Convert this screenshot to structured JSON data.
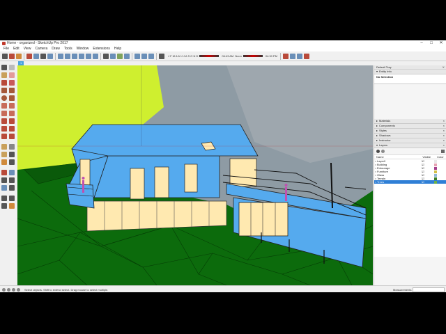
{
  "window": {
    "title": "Home - organized - SketchUp Pro 2017",
    "controls": [
      "–",
      "□",
      "✕"
    ]
  },
  "menus": [
    "File",
    "Edit",
    "View",
    "Camera",
    "Draw",
    "Tools",
    "Window",
    "Extensions",
    "Help"
  ],
  "shadow_settings": {
    "months": "J F M A M J J A S O N D",
    "time_start": "06:43 AM",
    "noon": "Noon",
    "time_end": "04:30 PM"
  },
  "scene_tab": "1",
  "tray": {
    "title": "Default Tray",
    "entity_info": {
      "label": "Entity Info",
      "value": "No Selection"
    },
    "panels": [
      {
        "label": "Materials"
      },
      {
        "label": "Components"
      },
      {
        "label": "Styles"
      },
      {
        "label": "Shadows"
      },
      {
        "label": "Instructor"
      }
    ],
    "layers": {
      "label": "Layers",
      "columns": {
        "name": "Name",
        "visible": "Visible",
        "color": "Color"
      },
      "rows": [
        {
          "name": "Layer0",
          "visible": "☑",
          "color": "#e9e9e9",
          "selected": false
        },
        {
          "name": "Building",
          "visible": "☑",
          "color": "#e6a3b3",
          "selected": false
        },
        {
          "name": "Entourage",
          "visible": "☑",
          "color": "#a53f8c",
          "selected": false
        },
        {
          "name": "Furniture",
          "visible": "☑",
          "color": "#d4c04a",
          "selected": false
        },
        {
          "name": "Glass",
          "visible": "☑",
          "color": "#8fb8d8",
          "selected": false
        },
        {
          "name": "Terrain",
          "visible": "☑",
          "color": "#3a7e2a",
          "selected": false
        },
        {
          "name": "Trees",
          "visible": "☑",
          "color": "#6ab04c",
          "selected": true
        }
      ]
    }
  },
  "status": {
    "message": "Select objects. Shift to extend select. Drag mouse to select multiple.",
    "measurements_label": "Measurements"
  },
  "colors": {
    "terrain": "#0c6b0c",
    "building": "#55aaee",
    "glass": "#ffe9b0",
    "tree": "#cfef2f",
    "sky": "#8e9ba4",
    "accent": "#2f7fd6"
  },
  "icons": {
    "main_toolbar": [
      "select",
      "eraser",
      "paint-bucket",
      "orbit",
      "pan",
      "zoom",
      "zoom-extents",
      "iso-view",
      "top-view",
      "front-view",
      "right-view",
      "back-view",
      "left-view",
      "xray",
      "shaded",
      "textured",
      "monochrome",
      "sections",
      "warehouse",
      "extension-warehouse",
      "layout",
      "ruby"
    ]
  }
}
